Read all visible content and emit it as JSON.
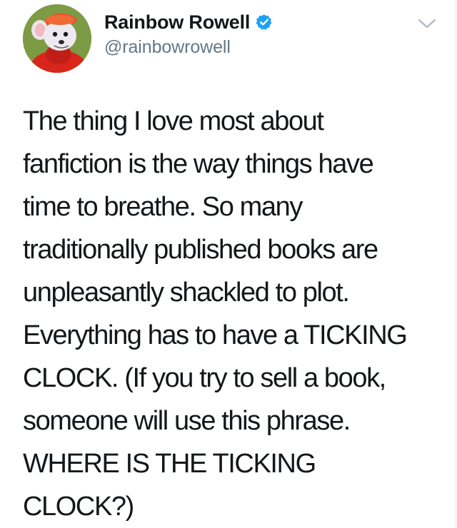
{
  "author": {
    "display_name": "Rainbow Rowell",
    "handle": "@rainbowrowell",
    "verified": true,
    "avatar_icon": "cartoon-mouse-avatar"
  },
  "menu": {
    "icon": "chevron-down-icon"
  },
  "tweet": {
    "lines": [
      "The thing I love most about",
      "fanfiction is the way things have",
      "time to breathe. So many",
      "traditionally published books are",
      "unpleasantly shackled to plot.",
      "Everything has to have a TICKING",
      "CLOCK. (If you try to sell a book,",
      "someone will use this phrase.",
      "WHERE IS THE TICKING",
      "CLOCK?)"
    ]
  },
  "colors": {
    "text": "#14171a",
    "secondary_text": "#657786",
    "verified_blue": "#1da1f2",
    "chevron": "#aab8c2"
  }
}
